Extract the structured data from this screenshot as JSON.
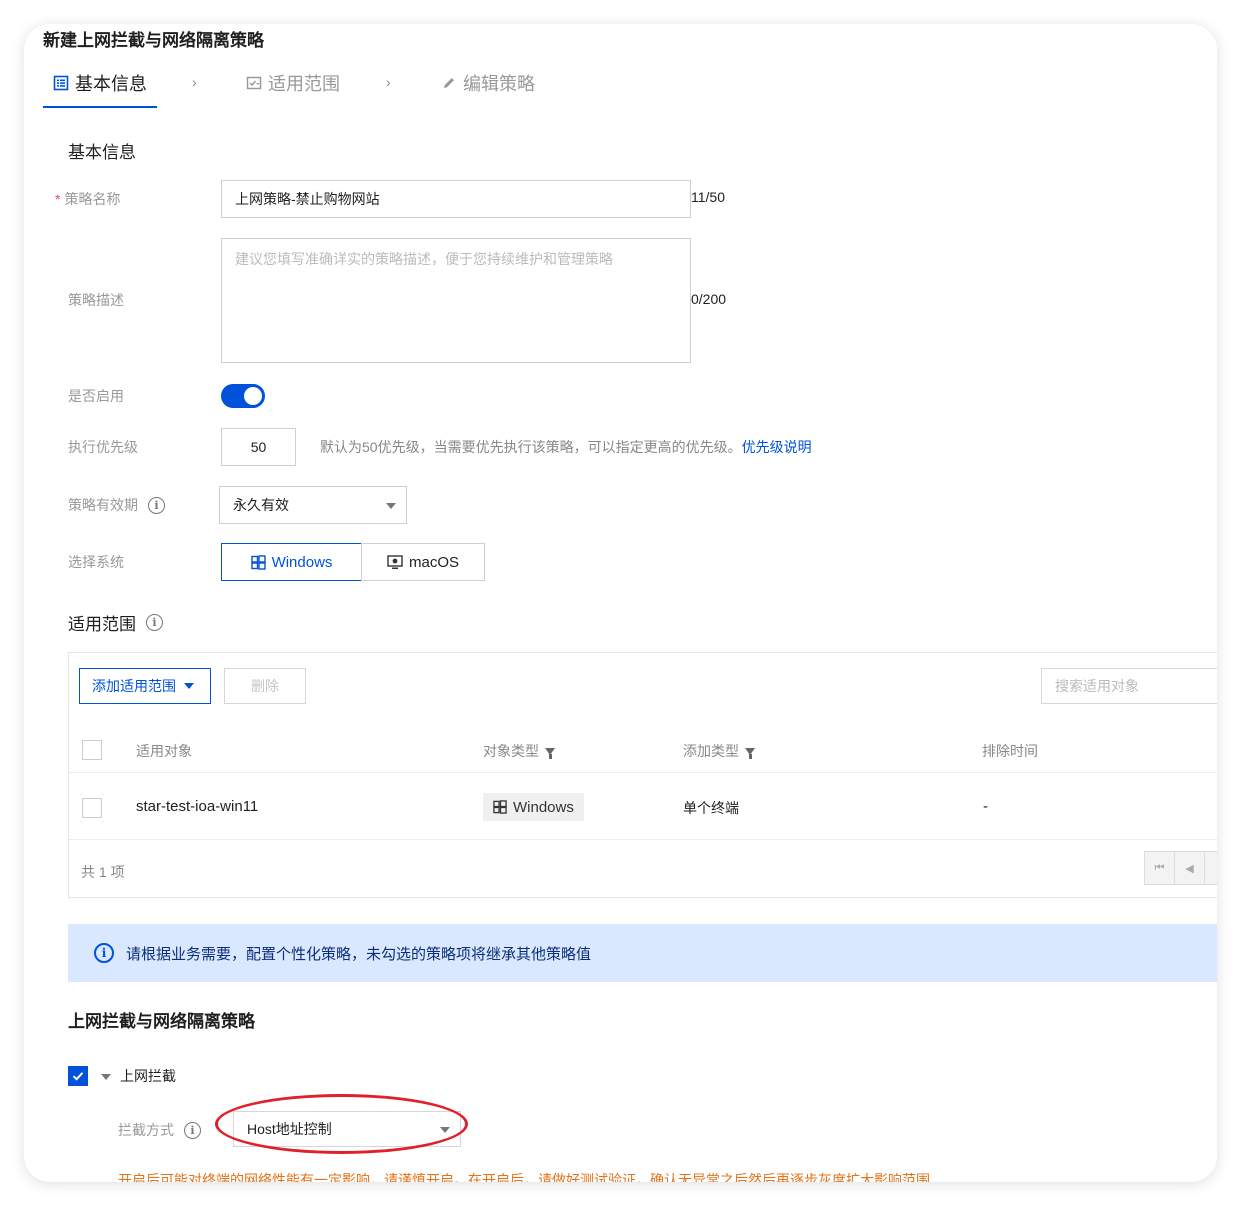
{
  "page": {
    "title": "新建上网拦截与网络隔离策略"
  },
  "steps": [
    {
      "label": "基本信息",
      "icon": "list-icon",
      "active": true
    },
    {
      "label": "适用范围",
      "icon": "checklist-icon",
      "active": false
    },
    {
      "label": "编辑策略",
      "icon": "pencil-icon",
      "active": false
    }
  ],
  "basic": {
    "section_title": "基本信息",
    "name_label": "策略名称",
    "required_mark": "*",
    "name_value": "上网策略-禁止购物网站",
    "name_counter": "11/50",
    "desc_label": "策略描述",
    "desc_placeholder": "建议您填写准确详实的策略描述，便于您持续维护和管理策略",
    "desc_counter": "0/200",
    "enable_label": "是否启用",
    "enabled": true,
    "priority_label": "执行优先级",
    "priority_value": "50",
    "priority_hint": "默认为50优先级，当需要优先执行该策略，可以指定更高的优先级。",
    "priority_link": "优先级说明",
    "validity_label": "策略有效期",
    "validity_value": "永久有效",
    "system_label": "选择系统",
    "system_options": [
      "Windows",
      "macOS"
    ],
    "system_selected": "Windows"
  },
  "scope": {
    "section_title": "适用范围",
    "add_button": "添加适用范围",
    "delete_button": "删除",
    "search_placeholder": "搜索适用对象",
    "columns": [
      "适用对象",
      "对象类型",
      "添加类型",
      "排除时间"
    ],
    "rows": [
      {
        "object": "star-test-ioa-win11",
        "type": "Windows",
        "add_type": "单个终端",
        "exclude_time": "-"
      }
    ],
    "total": "共 1 项"
  },
  "alert": {
    "text": "请根据业务需要，配置个性化策略，未勾选的策略项将继承其他策略值"
  },
  "policy": {
    "section_title": "上网拦截与网络隔离策略",
    "group_label": "上网拦截",
    "group_checked": true,
    "method_label": "拦截方式",
    "method_value": "Host地址控制",
    "warning": "开启后可能对终端的网络性能有一定影响，请谨慎开启。在开启后，请做好测试验证，确认无异常之后然后再逐步灰度扩大影响范围"
  },
  "colors": {
    "primary": "#0052d9",
    "alert_bg": "#d9e8ff",
    "warning": "#e37318",
    "annotation": "#e0202a"
  }
}
